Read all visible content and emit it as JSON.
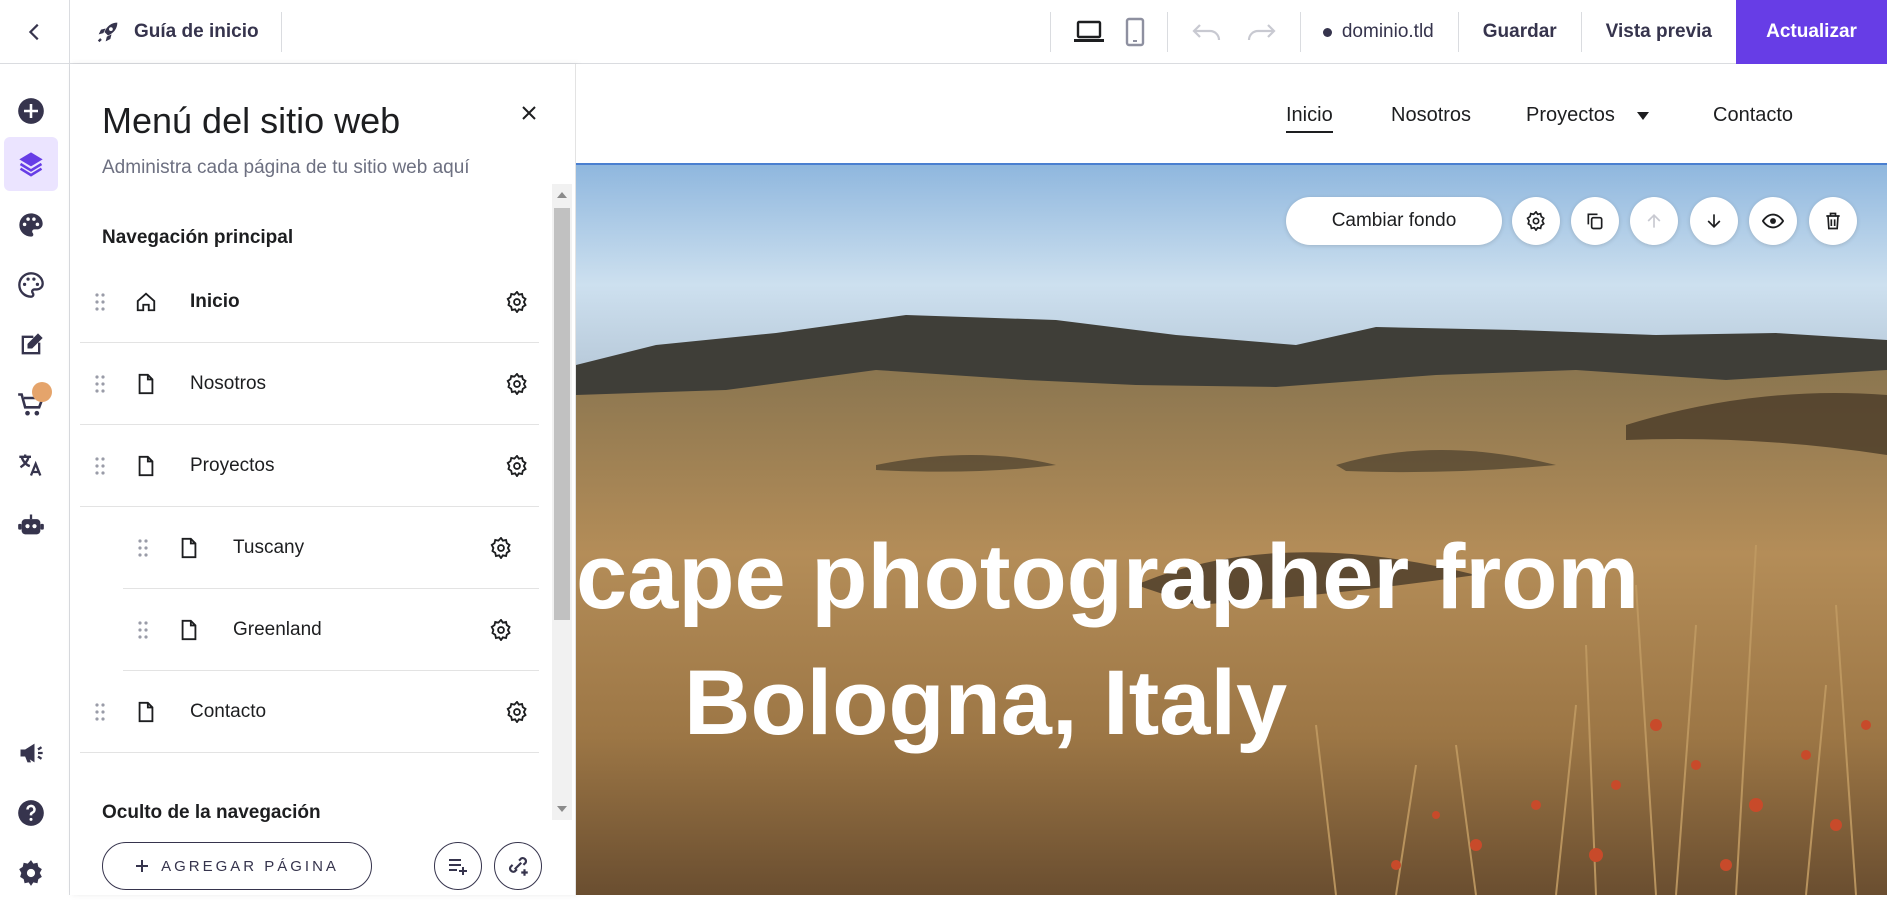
{
  "topbar": {
    "guide_label": "Guía de inicio",
    "domain": "dominio.tld",
    "save_label": "Guardar",
    "preview_label": "Vista previa",
    "update_label": "Actualizar"
  },
  "panel": {
    "title": "Menú del sitio web",
    "subtitle": "Administra cada página de tu sitio web aquí",
    "main_nav_title": "Navegación principal",
    "hidden_nav_title": "Oculto de la navegación",
    "pages": [
      {
        "label": "Inicio",
        "icon": "home-icon"
      },
      {
        "label": "Nosotros",
        "icon": "page-icon"
      },
      {
        "label": "Proyectos",
        "icon": "page-icon"
      },
      {
        "label": "Tuscany",
        "icon": "page-icon",
        "subpage": true
      },
      {
        "label": "Greenland",
        "icon": "page-icon",
        "subpage": true
      },
      {
        "label": "Contacto",
        "icon": "page-icon"
      }
    ],
    "add_page_label": "AGREGAR PÁGINA"
  },
  "site": {
    "nav": [
      "Inicio",
      "Nosotros",
      "Proyectos",
      "Contacto"
    ],
    "hero_line1": "cape photographer from",
    "hero_line2": "Bologna, Italy",
    "change_bg_label": "Cambiar fondo"
  },
  "colors": {
    "accent": "#673de6",
    "active_rail_bg": "#ebe4ff",
    "badge": "#e5a46b"
  }
}
